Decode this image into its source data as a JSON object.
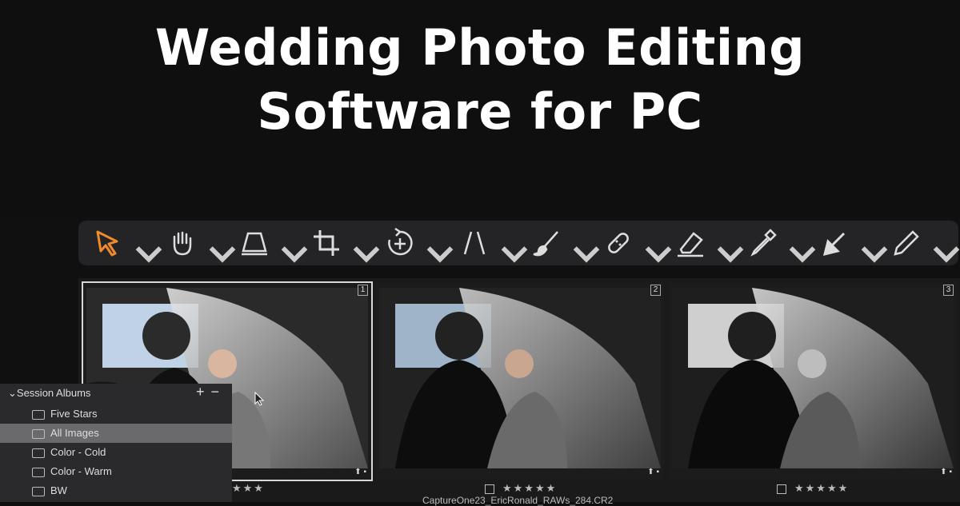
{
  "headline": {
    "line1": "Wedding Photo Editing",
    "line2": "Software for PC"
  },
  "toolbar": {
    "tools": [
      {
        "icon": "cursor-arrow-icon",
        "active": true
      },
      {
        "icon": "hand-pan-icon"
      },
      {
        "icon": "keystone-icon"
      },
      {
        "icon": "crop-icon"
      },
      {
        "icon": "rotate-icon"
      },
      {
        "icon": "straighten-icon"
      },
      {
        "icon": "brush-icon"
      },
      {
        "icon": "heal-bandage-icon"
      },
      {
        "icon": "eraser-icon"
      },
      {
        "icon": "eyedropper-icon"
      },
      {
        "icon": "arrow-down-left-icon"
      },
      {
        "icon": "pencil-icon"
      }
    ],
    "accent": "#f08a2a"
  },
  "thumbnails": [
    {
      "index": "1",
      "rating": "★★★",
      "selected": true
    },
    {
      "index": "2",
      "rating": "★★★★★",
      "selected": false
    },
    {
      "index": "3",
      "rating": "★★★★★",
      "selected": false
    }
  ],
  "filename": "CaptureOne23_EricRonald_RAWs_284.CR2",
  "session_albums": {
    "title": "Session Albums",
    "add": "+",
    "remove": "−",
    "items": [
      {
        "label": "Five Stars"
      },
      {
        "label": "All Images",
        "active": true
      },
      {
        "label": "Color - Cold"
      },
      {
        "label": "Color - Warm"
      },
      {
        "label": "BW"
      }
    ]
  }
}
